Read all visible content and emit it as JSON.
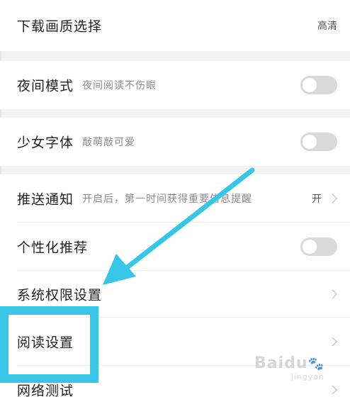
{
  "settings": {
    "download_quality": {
      "title": "下载画质选择",
      "value": "高清"
    },
    "night_mode": {
      "title": "夜间模式",
      "subtitle": "夜间阅读不伤眼",
      "enabled": false
    },
    "girl_font": {
      "title": "少女字体",
      "subtitle": "敲萌敲可爱",
      "enabled": false
    },
    "push_notification": {
      "title": "推送通知",
      "subtitle": "开启后，第一时间获得重要信息提醒",
      "value": "开"
    },
    "personalized_recommend": {
      "title": "个性化推荐",
      "enabled": false
    },
    "system_permissions": {
      "title": "系统权限设置"
    },
    "reading_settings": {
      "title": "阅读设置"
    },
    "network_test": {
      "title": "网络测试"
    }
  },
  "annotation": {
    "highlight_color": "#37c6e8"
  },
  "watermark": {
    "text": "Baidu",
    "sub": "jingyan"
  }
}
